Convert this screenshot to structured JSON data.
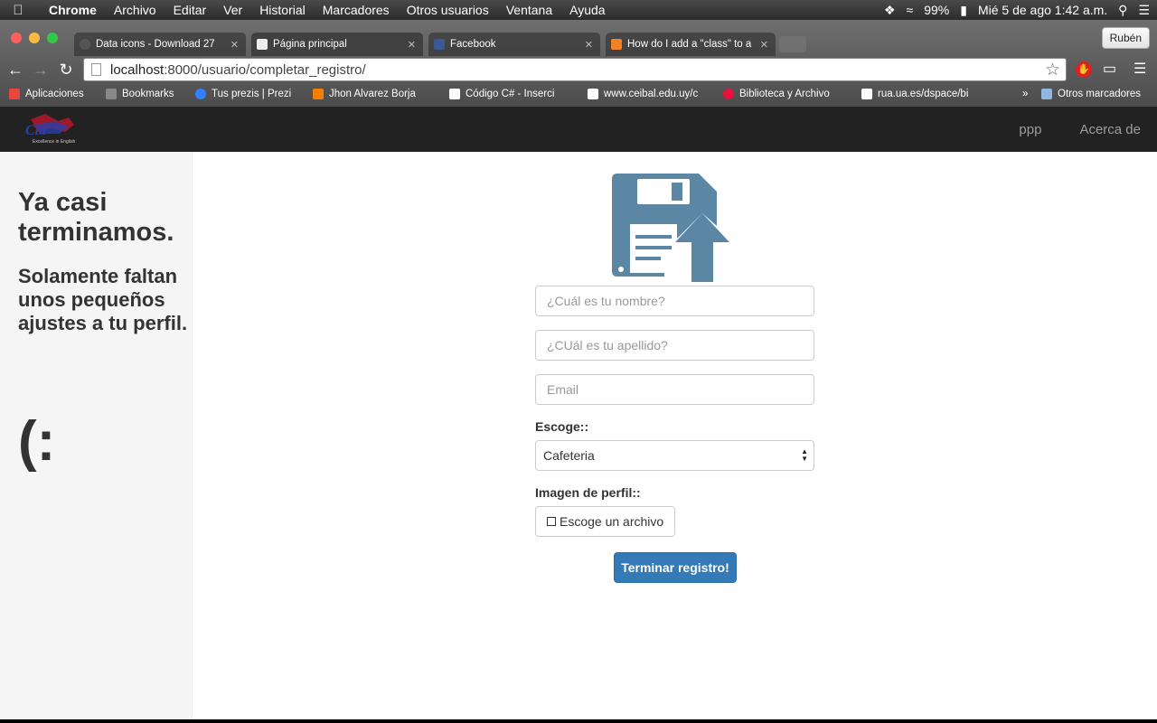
{
  "menubar": {
    "app": "Chrome",
    "items": [
      "Archivo",
      "Editar",
      "Ver",
      "Historial",
      "Marcadores",
      "Otros usuarios",
      "Ventana",
      "Ayuda"
    ],
    "battery": "99%",
    "datetime": "Mié 5 de ago  1:42 a.m."
  },
  "browser": {
    "tabs": [
      {
        "label": "Data icons - Download 27",
        "favicon_color": "#555555"
      },
      {
        "label": "Página principal",
        "favicon_color": "#eeeeee"
      },
      {
        "label": "Facebook",
        "favicon_color": "#3b5998"
      },
      {
        "label": "How do I add a \"class\" to a",
        "favicon_color": "#f48024"
      }
    ],
    "profile_name": "Rubén",
    "url_host": "localhost",
    "url_path": ":8000/usuario/completar_registro/",
    "bookmarks": [
      {
        "label": "Aplicaciones",
        "color": "#e8453c"
      },
      {
        "label": "Bookmarks",
        "color": "#888888"
      },
      {
        "label": "Tus prezis | Prezi",
        "color": "#3181ff"
      },
      {
        "label": "Jhon Alvarez Borja",
        "color": "#f57d00"
      },
      {
        "label": "Código C# - Inserci",
        "color": "#ffffff"
      },
      {
        "label": "www.ceibal.edu.uy/c",
        "color": "#ffffff"
      },
      {
        "label": "Biblioteca y Archivo",
        "color": "#e8103c"
      },
      {
        "label": "rua.ua.es/dspace/bi",
        "color": "#ffffff"
      },
      {
        "label": "Otros marcadores",
        "color": "#8fb8e0"
      }
    ]
  },
  "site": {
    "logo_text": "Cla",
    "logo_tagline": "Excellence in English",
    "nav": [
      "ppp",
      "Acerca de"
    ]
  },
  "sidebar": {
    "title": "Ya casi terminamos.",
    "subtitle": "Solamente faltan unos pequeños ajustes a tu perfil.",
    "emoticon": "(:"
  },
  "form": {
    "name_placeholder": "¿Cuál es tu nombre?",
    "lastname_placeholder": "¿CUál es tu apellido?",
    "email_placeholder": "Email",
    "choose_label": "Escoge::",
    "choose_value": "Cafeteria",
    "image_label": "Imagen de perfil::",
    "file_button": "Escoge un archivo",
    "submit": "Terminar registro!",
    "icon_color": "#5b87a5"
  }
}
